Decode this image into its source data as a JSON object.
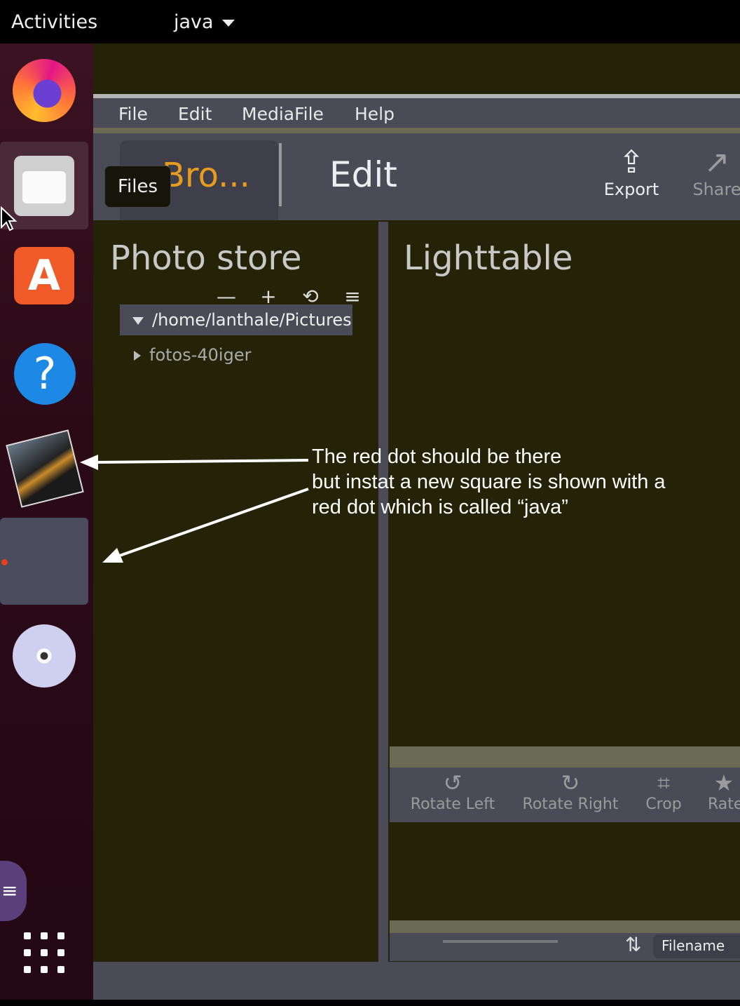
{
  "topbar": {
    "activities": "Activities",
    "app_menu": "java"
  },
  "dock": {
    "items": [
      "firefox-icon",
      "files-icon",
      "software-store-icon",
      "help-icon",
      "photo-app-icon",
      "java-window",
      "disc-icon"
    ],
    "show_apps_icon": "grid-icon",
    "running_indicator_color": "#e6421b"
  },
  "tooltip": {
    "label": "Files"
  },
  "app": {
    "menu": [
      "File",
      "Edit",
      "MediaFile",
      "Help"
    ],
    "tabs": {
      "browse": "Bro...",
      "edit": "Edit"
    },
    "toolbar": {
      "export": "Export",
      "share": "Share"
    },
    "photo_store": {
      "title": "Photo store",
      "tools": [
        "—",
        "+",
        "⟲",
        "≡"
      ],
      "root_path": "/home/lanthale/Pictures",
      "children": [
        "fotos-40iger"
      ]
    },
    "lighttable": {
      "title": "Lighttable",
      "actions": {
        "rotate_left": "Rotate Left",
        "rotate_right": "Rotate Right",
        "crop": "Crop",
        "rate": "Rate"
      },
      "sort_field": "Filename"
    }
  },
  "annotation": {
    "line1": "The red dot should be there",
    "line2": "but instat a new square is shown with a",
    "line3": "red dot which is called “java”"
  },
  "colors": {
    "accent_tab": "#e89c1f",
    "panel_bg": "#242207",
    "bar_bg": "#4a4b56",
    "dock_bg": "#2b0a16"
  }
}
